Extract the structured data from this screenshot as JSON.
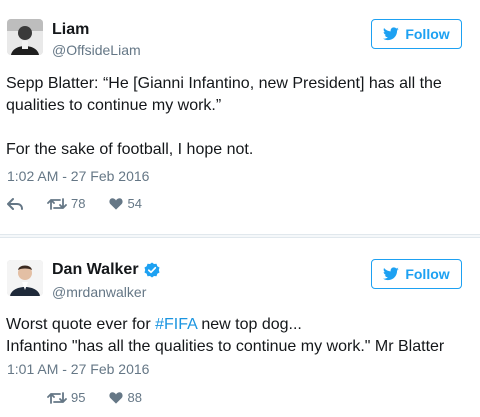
{
  "colors": {
    "accent": "#1da1f2",
    "muted": "#657786",
    "text": "#14171a",
    "hashtag": "#1b95e0"
  },
  "tweets": [
    {
      "display_name": "Liam",
      "handle": "@OffsideLiam",
      "verified": false,
      "follow_label": "Follow",
      "text_line_1": "Sepp Blatter: “He [Gianni Infantino, new President] has all the qualities to continue my work.”",
      "text_line_2": "For the sake of football, I hope not.",
      "timestamp": "1:02 AM - 27 Feb 2016",
      "retweets": "78",
      "likes": "54",
      "icons": [
        "reply-icon",
        "retweet-icon",
        "heart-icon",
        "twitter-bird-icon"
      ]
    },
    {
      "display_name": "Dan Walker",
      "handle": "@mrdanwalker",
      "verified": true,
      "follow_label": "Follow",
      "text_before_hashtag": "Worst quote ever for ",
      "hashtag": "#FIFA",
      "text_after_hashtag": " new top dog...",
      "text_line_2": "Infantino \"has all the qualities to continue my work.\" Mr Blatter",
      "timestamp": "1:01 AM - 27 Feb 2016",
      "retweets": "95",
      "likes": "88",
      "icons": [
        "verified-badge-icon",
        "retweet-icon",
        "heart-icon",
        "twitter-bird-icon"
      ]
    }
  ]
}
